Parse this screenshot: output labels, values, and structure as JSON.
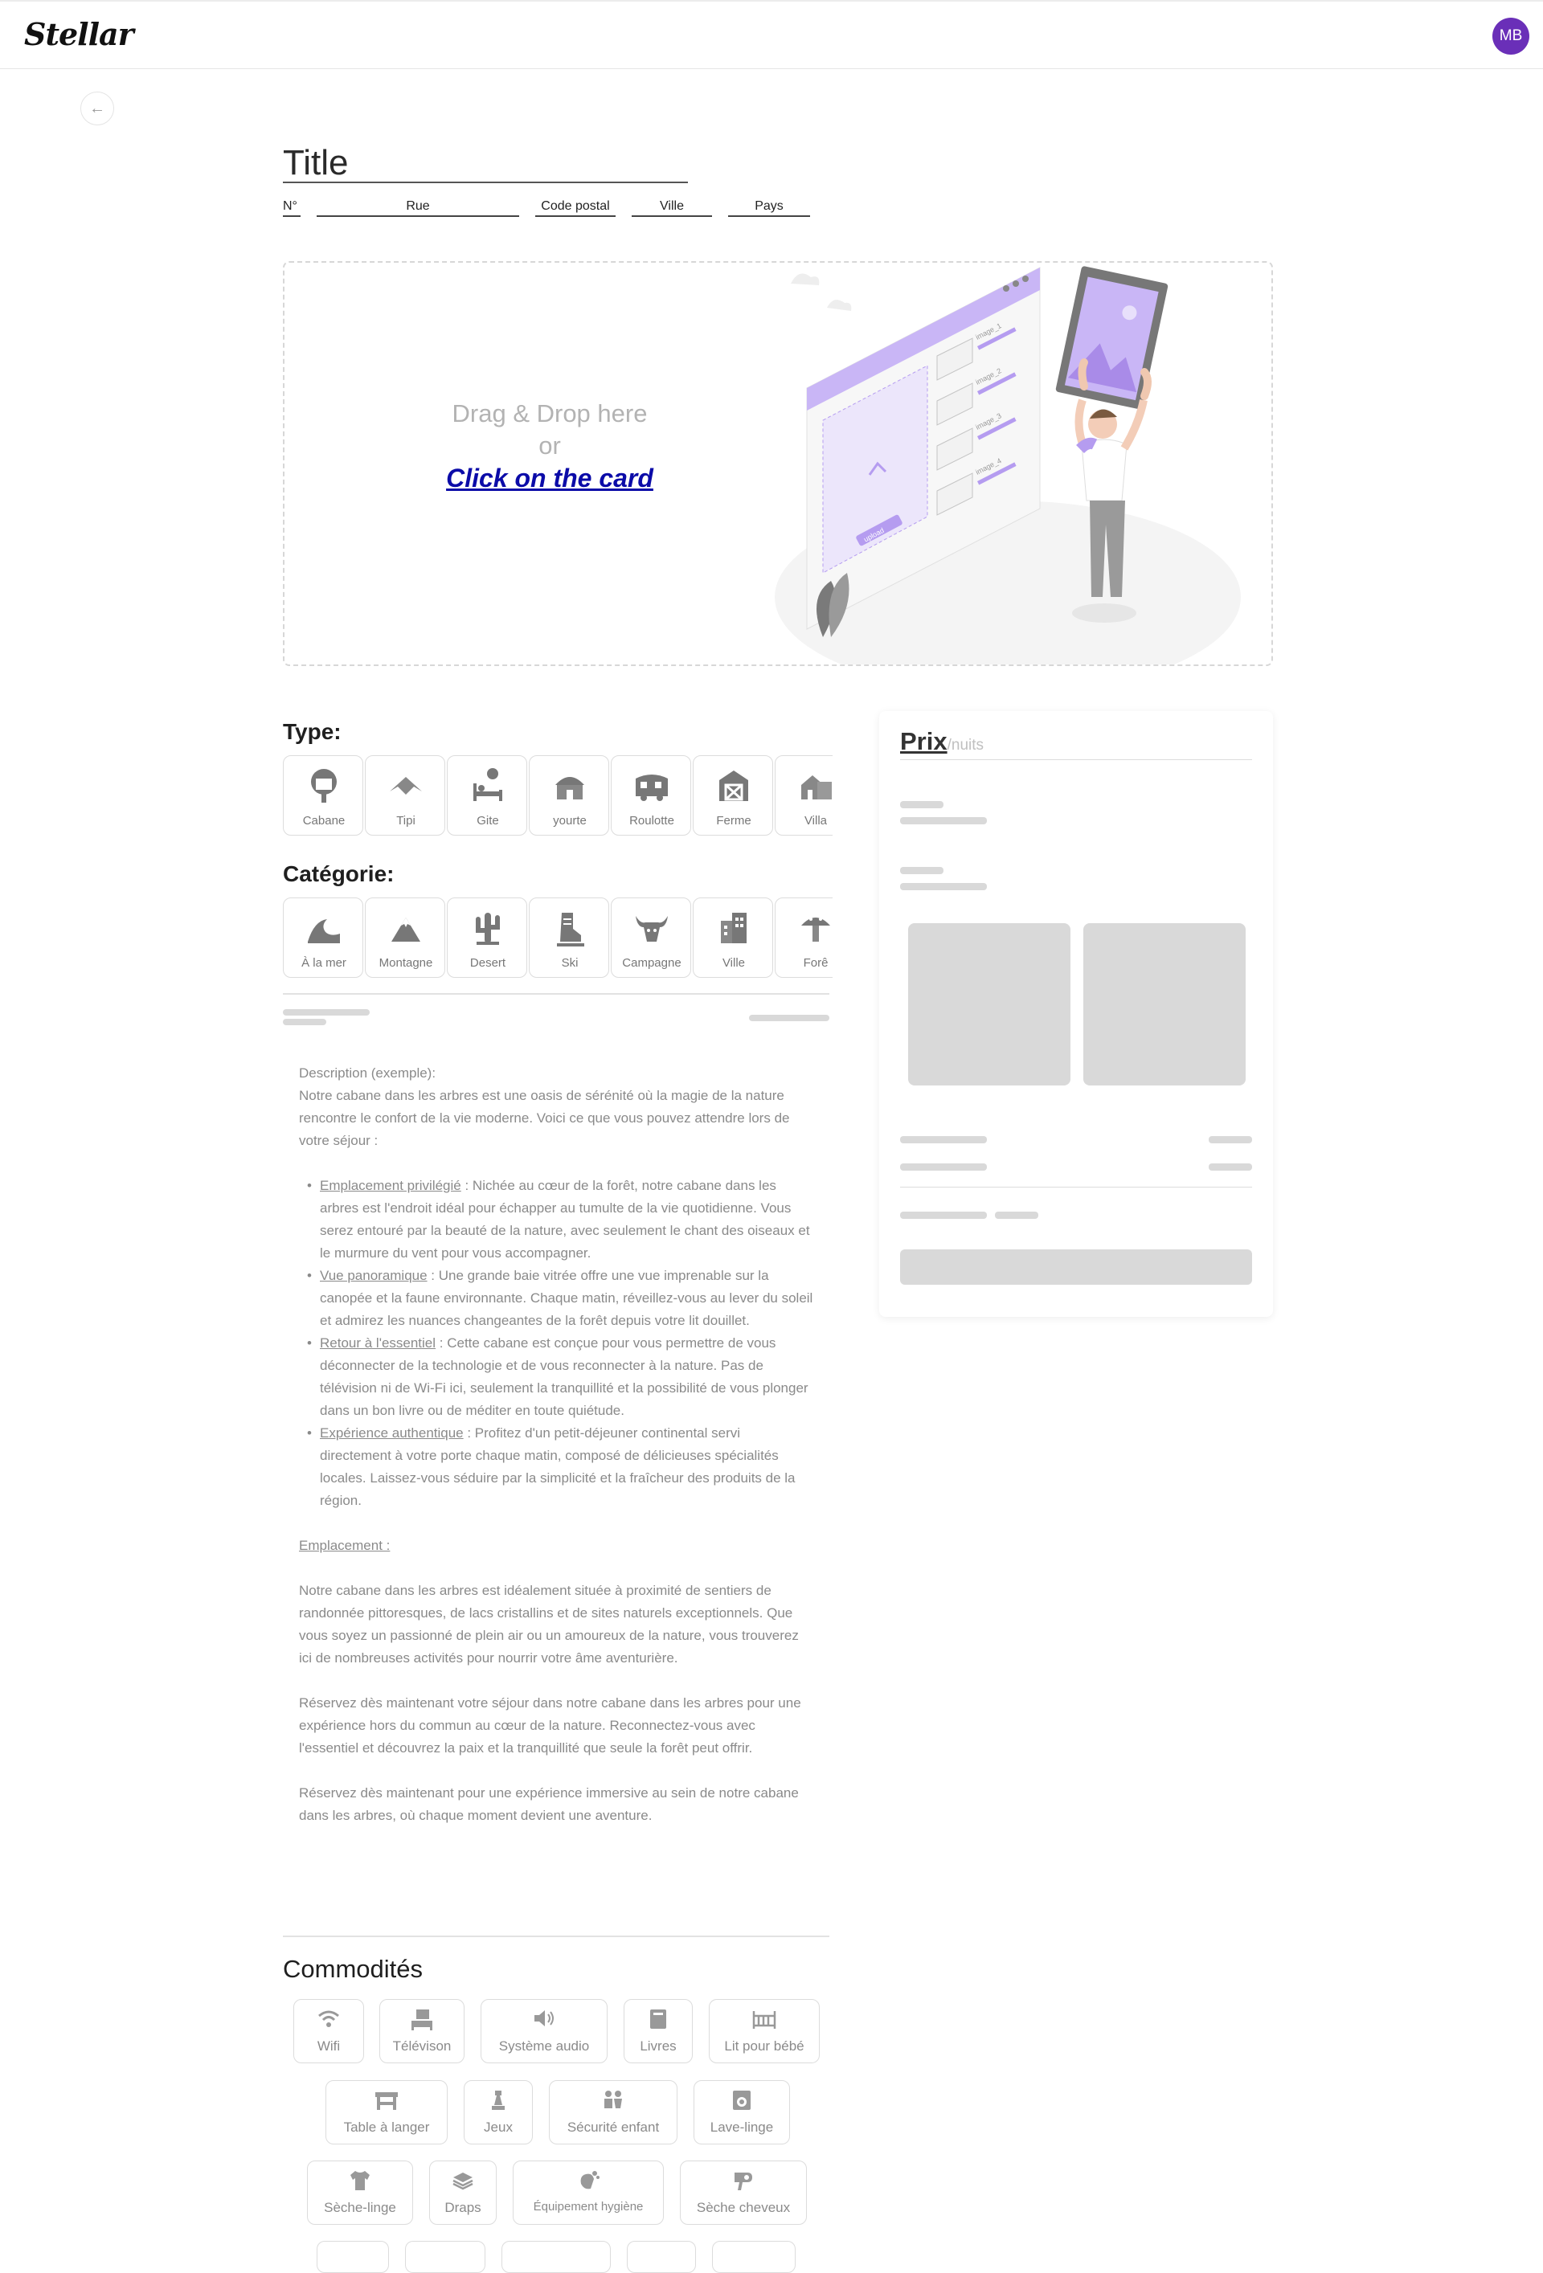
{
  "header": {
    "logo": "Stellar",
    "avatar_initials": "MB"
  },
  "form": {
    "title": "Title",
    "address": {
      "number": "N°",
      "street": "Rue",
      "postal_code": "Code postal",
      "city": "Ville",
      "country": "Pays"
    }
  },
  "dropzone": {
    "line1": "Drag & Drop here",
    "line2": "or",
    "link": "Click on the card"
  },
  "illustration": {
    "image_labels": [
      "image_1",
      "image_2",
      "image_3",
      "image_4"
    ],
    "upload_label": "upload"
  },
  "type_section": {
    "heading": "Type:",
    "chips": [
      {
        "label": "Cabane",
        "icon": "treehouse-icon"
      },
      {
        "label": "Tipi",
        "icon": "tipi-icon"
      },
      {
        "label": "Gite",
        "icon": "bed-icon"
      },
      {
        "label": "yourte",
        "icon": "yurt-icon"
      },
      {
        "label": "Roulotte",
        "icon": "caravan-icon"
      },
      {
        "label": "Ferme",
        "icon": "barn-icon"
      },
      {
        "label": "Villa",
        "icon": "villa-icon"
      }
    ]
  },
  "category_section": {
    "heading": "Catégorie:",
    "chips": [
      {
        "label": "À la mer",
        "icon": "wave-icon"
      },
      {
        "label": "Montagne",
        "icon": "mountain-icon"
      },
      {
        "label": "Desert",
        "icon": "cactus-icon"
      },
      {
        "label": "Ski",
        "icon": "ski-boot-icon"
      },
      {
        "label": "Campagne",
        "icon": "bull-skull-icon"
      },
      {
        "label": "Ville",
        "icon": "building-icon"
      },
      {
        "label": "Forê",
        "icon": "mushroom-icon"
      }
    ]
  },
  "description": {
    "intro_label": "Description (exemple):",
    "intro": "Notre cabane dans les arbres est une oasis de sérénité où la magie de la nature rencontre le confort de la vie moderne. Voici ce que vous pouvez attendre lors de votre séjour :",
    "bullets": [
      {
        "title": "Emplacement privilégié",
        "text": " : Nichée au cœur de la forêt, notre cabane dans les arbres est l'endroit idéal pour échapper au tumulte de la vie quotidienne. Vous serez entouré par la beauté de la nature, avec seulement le chant des oiseaux et le murmure du vent pour vous accompagner."
      },
      {
        "title": "Vue panoramique",
        "text": " : Une grande baie vitrée offre une vue imprenable sur la canopée et la faune environnante. Chaque matin, réveillez-vous au lever du soleil et admirez les nuances changeantes de la forêt depuis votre lit douillet."
      },
      {
        "title": "Retour à l'essentiel",
        "text": " : Cette cabane est conçue pour vous permettre de vous déconnecter de la technologie et de vous reconnecter à la nature. Pas de télévision ni de Wi-Fi ici, seulement la tranquillité et la possibilité de vous plonger dans un bon livre ou de méditer en toute quiétude."
      },
      {
        "title": "Expérience authentique",
        "text": " : Profitez d'un petit-déjeuner continental servi directement à votre porte chaque matin, composé de délicieuses spécialités locales. Laissez-vous séduire par la simplicité et la fraîcheur des produits de la région."
      }
    ],
    "location_label": "Emplacement :",
    "location_text": "Notre cabane dans les arbres est idéalement située à proximité de sentiers de randonnée pittoresques, de lacs cristallins et de sites naturels exceptionnels. Que vous soyez un passionné de plein air ou un amoureux de la nature, vous trouverez ici de nombreuses activités pour nourrir votre âme aventurière.",
    "cta1": "Réservez dès maintenant votre séjour dans notre cabane dans les arbres pour une expérience hors du commun au cœur de la nature. Reconnectez-vous avec l'essentiel et découvrez la paix et la tranquillité que seule la forêt peut offrir.",
    "cta2": "Réservez dès maintenant pour une expérience immersive au sein de notre cabane dans les arbres, où chaque moment devient une aventure."
  },
  "amenities": {
    "heading": "Commodités",
    "items": [
      {
        "label": "Wifi",
        "icon": "wifi-icon"
      },
      {
        "label": "Télévison",
        "icon": "tv-icon"
      },
      {
        "label": "Système audio",
        "icon": "speaker-icon"
      },
      {
        "label": "Livres",
        "icon": "book-icon"
      },
      {
        "label": "Lit pour bébé",
        "icon": "crib-icon"
      },
      {
        "label": "Table à langer",
        "icon": "changing-table-icon"
      },
      {
        "label": "Jeux",
        "icon": "chess-icon"
      },
      {
        "label": "Sécurité enfant",
        "icon": "children-icon"
      },
      {
        "label": "Lave-linge",
        "icon": "washing-machine-icon"
      },
      {
        "label": "Sèche-linge",
        "icon": "shirt-icon"
      },
      {
        "label": "Draps",
        "icon": "sheets-icon"
      },
      {
        "label": "Équipement hygiène",
        "icon": "hygiene-icon"
      },
      {
        "label": "Sèche cheveux",
        "icon": "hair-dryer-icon"
      }
    ]
  },
  "price_card": {
    "title": "Prix",
    "unit": "/nuits"
  },
  "colors": {
    "accent": "#6a2fb8",
    "link": "#0b0ba8",
    "illustration_purple": "#b59cf0",
    "skeleton": "#d9d9d9"
  }
}
